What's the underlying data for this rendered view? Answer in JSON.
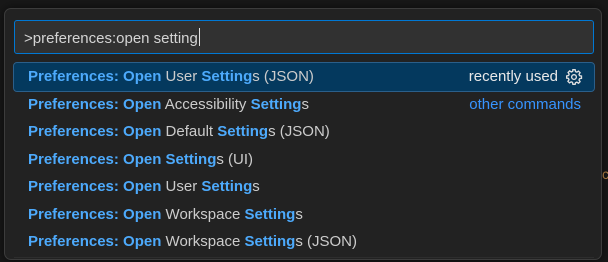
{
  "command_palette": {
    "input": {
      "value": ">preferences:open setting"
    },
    "items": [
      {
        "segments": [
          {
            "text": "Preferences: Open",
            "match": true
          },
          {
            "text": " User ",
            "match": false
          },
          {
            "text": "Setting",
            "match": true
          },
          {
            "text": "s (JSON)",
            "match": false
          }
        ],
        "aside": "recently used",
        "aside_icon": "gear-icon",
        "selected": true
      },
      {
        "segments": [
          {
            "text": "Preferences: Open",
            "match": true
          },
          {
            "text": " Accessibility ",
            "match": false
          },
          {
            "text": "Setting",
            "match": true
          },
          {
            "text": "s",
            "match": false
          }
        ],
        "aside": "other commands",
        "selected": false
      },
      {
        "segments": [
          {
            "text": "Preferences: Open",
            "match": true
          },
          {
            "text": " Default ",
            "match": false
          },
          {
            "text": "Setting",
            "match": true
          },
          {
            "text": "s (JSON)",
            "match": false
          }
        ],
        "selected": false
      },
      {
        "segments": [
          {
            "text": "Preferences: Open Setting",
            "match": true
          },
          {
            "text": "s (UI)",
            "match": false
          }
        ],
        "selected": false
      },
      {
        "segments": [
          {
            "text": "Preferences: Open",
            "match": true
          },
          {
            "text": " User ",
            "match": false
          },
          {
            "text": "Setting",
            "match": true
          },
          {
            "text": "s",
            "match": false
          }
        ],
        "selected": false
      },
      {
        "segments": [
          {
            "text": "Preferences: Open",
            "match": true
          },
          {
            "text": " Workspace ",
            "match": false
          },
          {
            "text": "Setting",
            "match": true
          },
          {
            "text": "s",
            "match": false
          }
        ],
        "selected": false
      },
      {
        "segments": [
          {
            "text": "Preferences: Open",
            "match": true
          },
          {
            "text": " Workspace ",
            "match": false
          },
          {
            "text": "Setting",
            "match": true
          },
          {
            "text": "s (JSON)",
            "match": false
          }
        ],
        "selected": false
      }
    ]
  },
  "colors": {
    "match_highlight": "#4daafc",
    "selected_row": "#04395e",
    "focus_border": "#0078d4",
    "link": "#3794ff"
  }
}
